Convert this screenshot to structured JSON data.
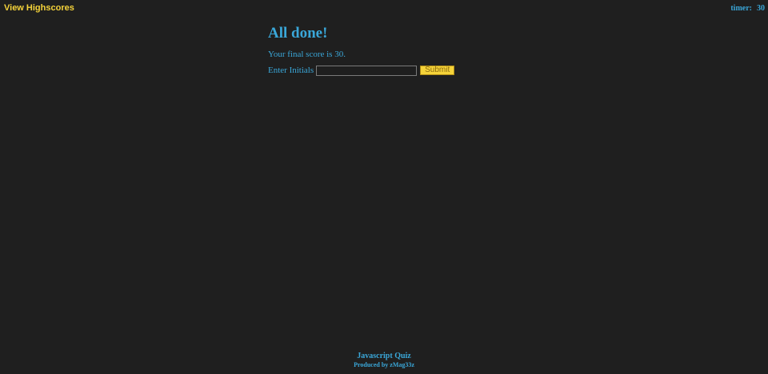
{
  "header": {
    "view_highscores_label": "View Highscores",
    "timer_label": "timer:",
    "timer_value": "30"
  },
  "main": {
    "title": "All done!",
    "final_score_prefix": "Your final score is ",
    "final_score_value": "30",
    "final_score_suffix": ".",
    "initials_label": "Enter Initials",
    "initials_value": "",
    "submit_label": "Submit"
  },
  "footer": {
    "title": "Javascript Quiz",
    "credit": "Produced by zMag33z"
  },
  "colors": {
    "background": "#1f1f1f",
    "accent_blue": "#3aa7d9",
    "accent_yellow": "#f5d33a"
  }
}
